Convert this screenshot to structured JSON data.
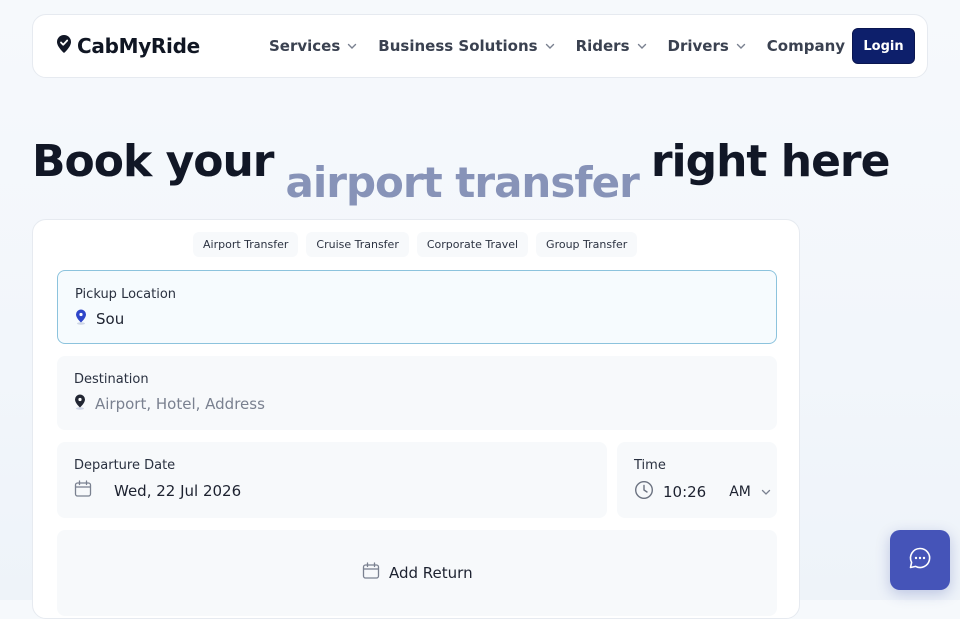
{
  "brand": {
    "name": "CabMyRide"
  },
  "nav": {
    "items": [
      {
        "label": "Services"
      },
      {
        "label": "Business Solutions"
      },
      {
        "label": "Riders"
      },
      {
        "label": "Drivers"
      },
      {
        "label": "Company"
      }
    ],
    "login_label": "Login"
  },
  "hero": {
    "prefix": "Book your",
    "rotating": "airport transfer",
    "suffix": "right here"
  },
  "booking": {
    "tabs": [
      {
        "label": "Airport Transfer"
      },
      {
        "label": "Cruise Transfer"
      },
      {
        "label": "Corporate Travel"
      },
      {
        "label": "Group Transfer"
      }
    ],
    "pickup": {
      "label": "Pickup Location",
      "value": "Sou"
    },
    "destination": {
      "label": "Destination",
      "placeholder": "Airport, Hotel, Address"
    },
    "departure": {
      "label": "Departure Date",
      "value": "Wed, 22 Jul 2026"
    },
    "time": {
      "label": "Time",
      "value": "10:26",
      "period": "AM"
    },
    "add_return_label": "Add Return"
  },
  "colors": {
    "accent": "#0d1f6b",
    "chat": "#4554b8",
    "pin_blue": "#2f46c9",
    "hero_accent": "#8793b8"
  },
  "icons": [
    "location-pin-icon",
    "chevron-down-icon",
    "calendar-icon",
    "clock-icon",
    "chat-icon"
  ]
}
